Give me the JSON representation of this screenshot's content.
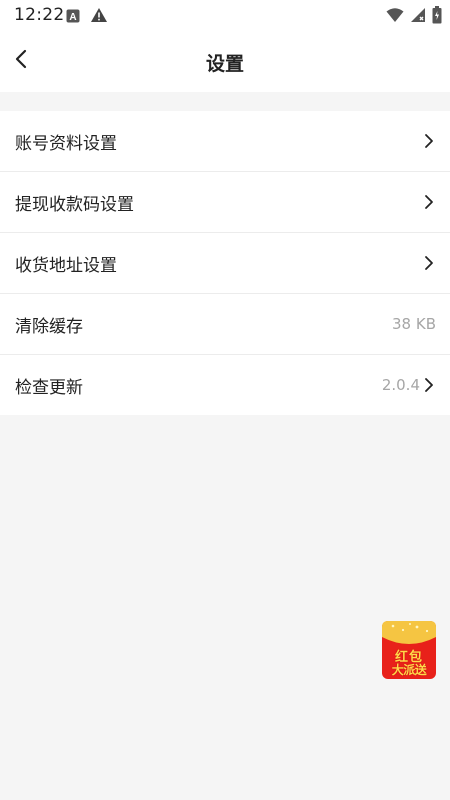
{
  "status_bar": {
    "time": "12:22",
    "left_icons": [
      "a-badge-icon",
      "warning-icon"
    ],
    "right_icons": [
      "wifi-icon",
      "signal-icon",
      "battery-icon"
    ]
  },
  "header": {
    "title": "设置",
    "back_icon": "back-arrow-icon"
  },
  "settings": {
    "items": [
      {
        "label": "账号资料设置",
        "value": "",
        "chevron": true
      },
      {
        "label": "提现收款码设置",
        "value": "",
        "chevron": true
      },
      {
        "label": "收货地址设置",
        "value": "",
        "chevron": true
      },
      {
        "label": "清除缓存",
        "value": "38 KB",
        "chevron": false
      },
      {
        "label": "检查更新",
        "value": "2.0.4",
        "chevron": true
      }
    ]
  },
  "floating_redpacket": {
    "line1": "红包",
    "line2": "大派送",
    "colors": {
      "body": "#e8211a",
      "flap": "#f5c542",
      "text": "#ffd94a"
    }
  },
  "colors": {
    "page_bg": "#f5f5f5",
    "card_bg": "#ffffff",
    "text_primary": "#222222",
    "text_secondary": "#a6a6a6",
    "divider": "#ececec"
  }
}
